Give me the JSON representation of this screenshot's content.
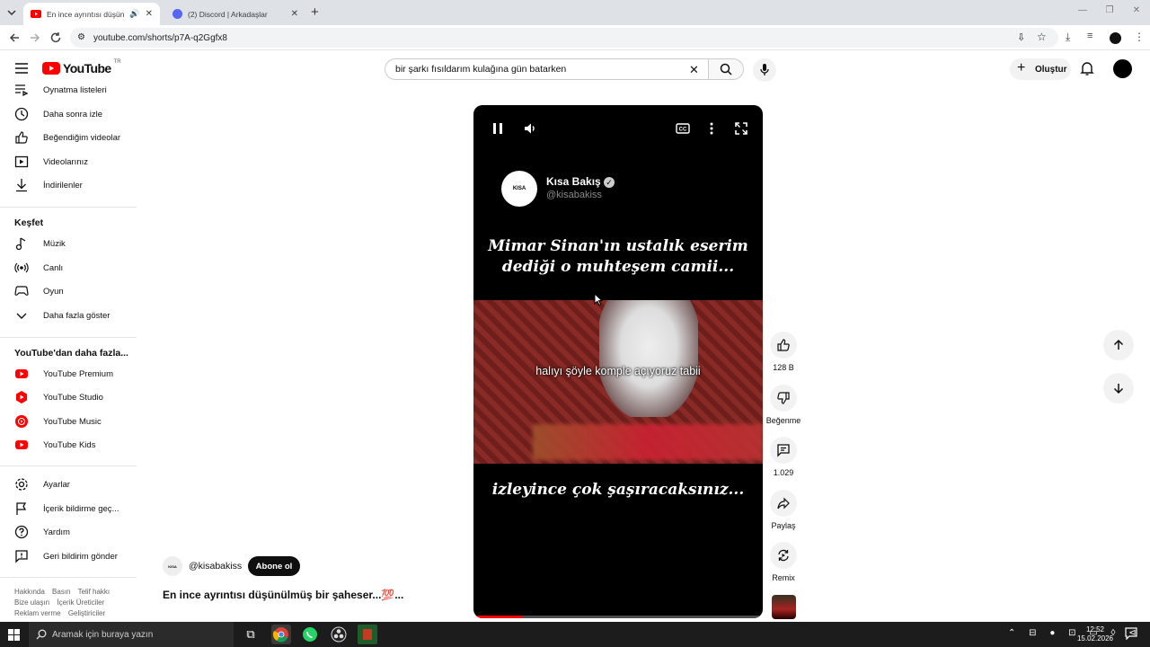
{
  "browser": {
    "tabs": [
      {
        "title": "En ince ayrıntısı düşünülmüş",
        "active": true,
        "icon": "youtube-favicon"
      },
      {
        "title": "(2) Discord | Arkadaşlar",
        "active": false,
        "icon": "discord-favicon"
      }
    ],
    "url": "youtube.com/shorts/p7A-q2Ggfx8"
  },
  "header": {
    "logo_text": "YouTube",
    "country": "TR",
    "search_value": "bir şarkı fısıldarım kulağına gün batarken",
    "create_label": "Oluştur"
  },
  "sidebar": {
    "items_top": [
      {
        "label": "Oynatma listeleri",
        "icon": "playlist-icon"
      },
      {
        "label": "Daha sonra izle",
        "icon": "clock-icon"
      },
      {
        "label": "Beğendiğim videolar",
        "icon": "like-icon"
      },
      {
        "label": "Videolarınız",
        "icon": "video-icon"
      },
      {
        "label": "İndirilenler",
        "icon": "download-icon"
      }
    ],
    "explore_title": "Keşfet",
    "explore_items": [
      {
        "label": "Müzik",
        "icon": "music-icon"
      },
      {
        "label": "Canlı",
        "icon": "live-icon"
      },
      {
        "label": "Oyun",
        "icon": "gaming-icon"
      },
      {
        "label": "Daha fazla göster",
        "icon": "chevron-down-icon"
      }
    ],
    "more_title": "YouTube'dan daha fazla...",
    "more_items": [
      {
        "label": "YouTube Premium"
      },
      {
        "label": "YouTube Studio"
      },
      {
        "label": "YouTube Music"
      },
      {
        "label": "YouTube Kids"
      }
    ],
    "settings_items": [
      {
        "label": "Ayarlar",
        "icon": "gear-icon"
      },
      {
        "label": "İçerik bildirme geç...",
        "icon": "flag-icon"
      },
      {
        "label": "Yardım",
        "icon": "help-icon"
      },
      {
        "label": "Geri bildirim gönder",
        "icon": "feedback-icon"
      }
    ],
    "footer": [
      [
        "Hakkında",
        "Basın",
        "Telif hakkı"
      ],
      [
        "Bize ulaşın",
        "İçerik Üreticiler"
      ],
      [
        "Reklam verme",
        "Geliştiriciler"
      ]
    ]
  },
  "player": {
    "channel_name": "Kısa Bakış",
    "channel_handle": "@kisabakiss",
    "avatar_text": "KISA",
    "caption_top": [
      "Mimar Sinan'ın ustalık eserim",
      "dediği o muhteşem camii..."
    ],
    "subtitle": "halıyı şöyle komple açıyoruz tabii",
    "caption_bottom": "izleyince çok şaşıracaksınız...",
    "progress_fraction": 0.17
  },
  "actions": {
    "likes": "128 B",
    "dislike": "Beğenme",
    "comments": "1.029",
    "share": "Paylaş",
    "remix": "Remix"
  },
  "meta": {
    "handle": "@kisabakiss",
    "subscribe": "Abone ol",
    "title": "En ince ayrıntısı düşünülmüş bir şaheser...💯..."
  },
  "taskbar": {
    "search_placeholder": "Aramak için buraya yazın",
    "time": "12:52",
    "date": "15.02.2026"
  },
  "colors": {
    "youtube_red": "#ff0000",
    "taskbar": "#1c1c1c"
  }
}
